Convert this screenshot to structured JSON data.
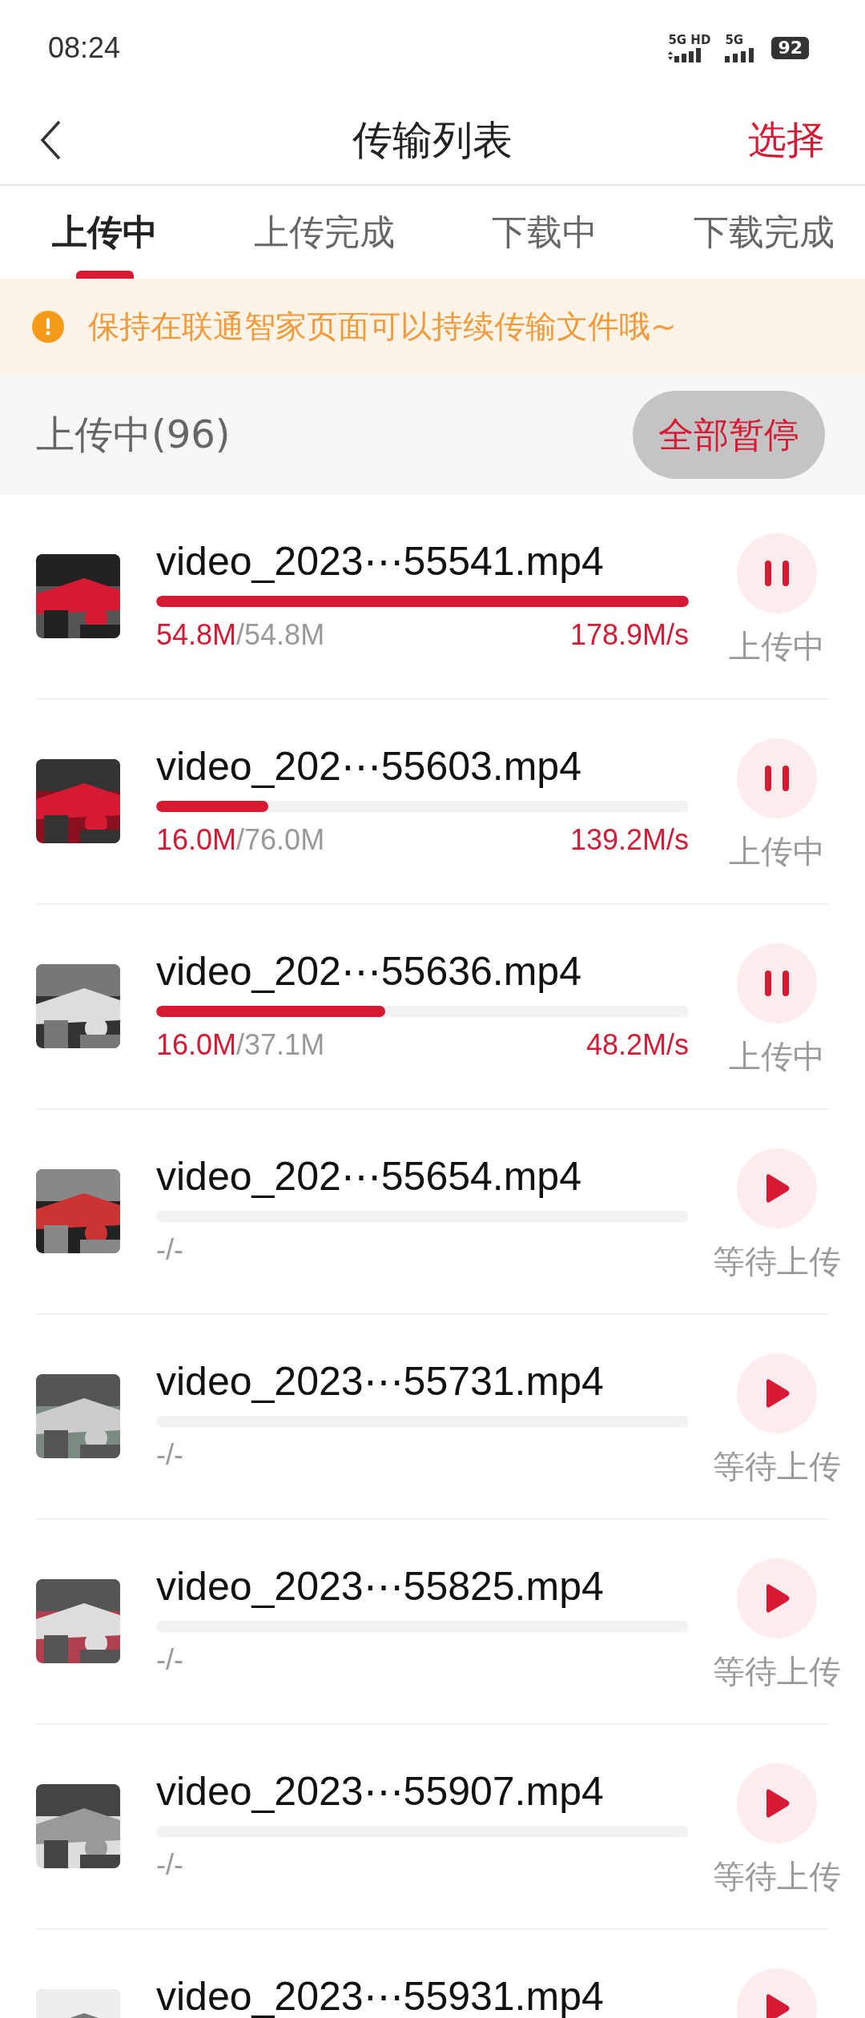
{
  "status_bar": {
    "time": "08:24",
    "network_1": "5G HD",
    "network_2": "5G",
    "battery": "92"
  },
  "header": {
    "title": "传输列表",
    "action": "选择"
  },
  "tabs": [
    {
      "label": "上传中",
      "selected": true
    },
    {
      "label": "上传完成",
      "selected": false
    },
    {
      "label": "下载中",
      "selected": false
    },
    {
      "label": "下载完成",
      "selected": false
    }
  ],
  "notice": "保持在联通智家页面可以持续传输文件哦~",
  "section": {
    "title": "上传中(96)",
    "button": "全部暂停"
  },
  "rows": [
    {
      "name": "video_2023⋯55541.mp4",
      "level": 1,
      "done": "54.8M",
      "total": "/54.8M",
      "speed": "178.9M/s",
      "kind": "pause",
      "status": "上传中"
    },
    {
      "name": "video_202⋯55603.mp4",
      "level": 0.21,
      "done": "16.0M",
      "total": "/76.0M",
      "speed": "139.2M/s",
      "kind": "pause",
      "status": "上传中"
    },
    {
      "name": "video_202⋯55636.mp4",
      "level": 0.43,
      "done": "16.0M",
      "total": "/37.1M",
      "speed": "48.2M/s",
      "kind": "pause",
      "status": "上传中"
    },
    {
      "name": "video_202⋯55654.mp4",
      "total": "-/-",
      "kind": "play",
      "status": "等待上传"
    },
    {
      "name": "video_2023⋯55731.mp4",
      "total": "-/-",
      "kind": "play",
      "status": "等待上传"
    },
    {
      "name": "video_2023⋯55825.mp4",
      "total": "-/-",
      "kind": "play",
      "status": "等待上传"
    },
    {
      "name": "video_2023⋯55907.mp4",
      "total": "-/-",
      "kind": "play",
      "status": "等待上传"
    },
    {
      "name": "video_2023⋯55931.mp4",
      "kind": "play"
    }
  ]
}
